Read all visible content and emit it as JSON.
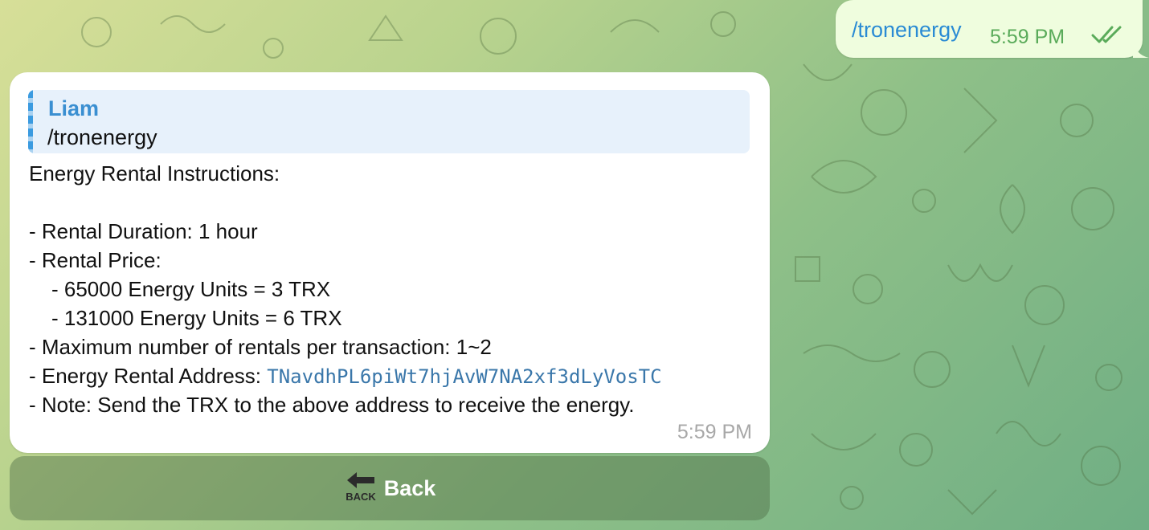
{
  "outgoing": {
    "text": "/tronenergy",
    "time": "5:59 PM",
    "status_icon": "double-check-icon"
  },
  "incoming": {
    "reply": {
      "name": "Liam",
      "text": "/tronenergy"
    },
    "lines": [
      "Energy Rental Instructions:",
      "",
      "- Rental Duration: 1 hour",
      "- Rental Price:",
      "- 65000 Energy Units = 3 TRX",
      "- 131000 Energy Units = 6 TRX",
      "- Maximum number of rentals per transaction: 1~2",
      "- Energy Rental Address: ",
      "- Note: Send the TRX to the above address to receive the energy."
    ],
    "address": "TNavdhPL6piWt7hjAvW7NA2xf3dLyVosTC",
    "time": "5:59 PM"
  },
  "keyboard": {
    "button_label": "Back",
    "button_icon": "back-arrow-icon",
    "icon_text": "BACK"
  },
  "colors": {
    "link": "#2a8bd4",
    "outgoing_bg": "#effdde",
    "time_green": "#5aab5a",
    "reply_name": "#3a8fd1",
    "address": "#3a77aa"
  }
}
